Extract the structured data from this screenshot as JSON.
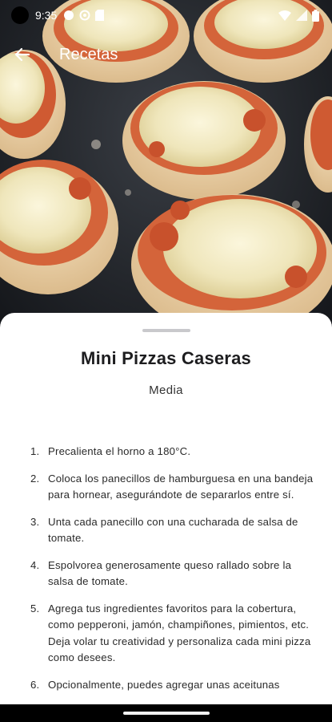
{
  "status_bar": {
    "time": "9:35",
    "icons_left": [
      "circle-icon",
      "settings-icon",
      "sim-icon"
    ],
    "icons_right": [
      "wifi-icon",
      "signal-icon",
      "battery-icon"
    ]
  },
  "app_bar": {
    "back_icon": "arrow-back-icon",
    "title": "Recetas"
  },
  "recipe": {
    "title": "Mini Pizzas Caseras",
    "difficulty": "Media",
    "steps": [
      {
        "number": "1.",
        "text": "Precalienta el horno a 180°C."
      },
      {
        "number": "2.",
        "text": "Coloca los panecillos de hamburguesa en una bandeja para hornear, asegurándote de separarlos entre sí."
      },
      {
        "number": "3.",
        "text": "Unta cada panecillo con una cucharada de salsa de tomate."
      },
      {
        "number": "4.",
        "text": "Espolvorea generosamente queso rallado sobre la salsa de tomate."
      },
      {
        "number": "5.",
        "text": "Agrega tus ingredientes favoritos para la cobertura, como pepperoni, jamón, champiñones, pimientos, etc. Deja volar tu creatividad y personaliza cada mini pizza como desees."
      },
      {
        "number": "6.",
        "text": "Opcionalmente, puedes agregar unas aceitunas"
      }
    ]
  },
  "colors": {
    "sheet_background": "#ffffff",
    "title_text": "#1d1d1f",
    "body_text": "#2a2a2a",
    "app_bar_text": "#ffffff"
  }
}
